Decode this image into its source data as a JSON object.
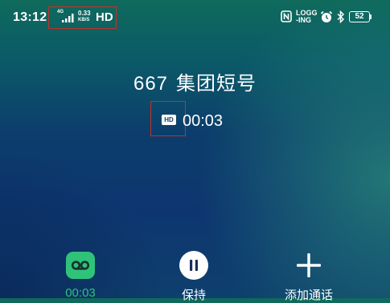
{
  "status_bar": {
    "time": "13:12",
    "network_type": "4G",
    "speed_value": "0.33",
    "speed_unit": "KB/S",
    "hd_label": "HD",
    "logging_line1": "LOGG",
    "logging_line2": "-ING",
    "battery_level": "52"
  },
  "call": {
    "number": "667",
    "name": "集团短号",
    "hd_badge": "HD",
    "duration": "00:03"
  },
  "controls": {
    "record_label": "00:03",
    "hold_label": "保持",
    "add_call_label": "添加通话"
  },
  "colors": {
    "record_accent": "#2fc37a",
    "highlight_box": "#c0332b"
  }
}
